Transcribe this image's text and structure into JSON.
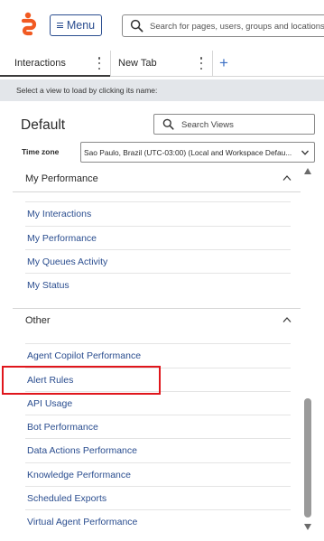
{
  "app": {
    "menu_label": "Menu",
    "search_placeholder": "Search for pages, users, groups and locations"
  },
  "tabs": [
    {
      "label": "Interactions"
    },
    {
      "label": "New Tab"
    }
  ],
  "info_message": "Select a view to load by clicking its name:",
  "panel": {
    "title": "Default",
    "search_views_label": "Search Views",
    "timezone_label": "Time zone",
    "timezone_value": "Sao Paulo, Brazil (UTC-03:00) (Local and Workspace Defau..."
  },
  "sections": [
    {
      "label": "My Performance",
      "items": [
        "My Interactions",
        "My Performance",
        "My Queues Activity",
        "My Status"
      ]
    },
    {
      "label": "Other",
      "items": [
        "Agent Copilot Performance",
        "Alert Rules",
        "API Usage",
        "Bot Performance",
        "Data Actions Performance",
        "Knowledge Performance",
        "Scheduled Exports",
        "Virtual Agent Performance"
      ]
    }
  ],
  "highlighted_item": "Alert Rules",
  "colors": {
    "brand_orange": "#f15a22",
    "link_blue": "#2a4d8f",
    "highlight_red": "#e0161c",
    "strip_gray": "#e3e6ea"
  },
  "icons": {
    "logo": "genesys-logo-icon",
    "menu": "hamburger-icon",
    "search": "search-icon",
    "tab_menu": "kebab-icon",
    "add_tab": "plus-icon",
    "dropdown": "chevron-down-icon",
    "collapse": "chevron-up-icon"
  }
}
